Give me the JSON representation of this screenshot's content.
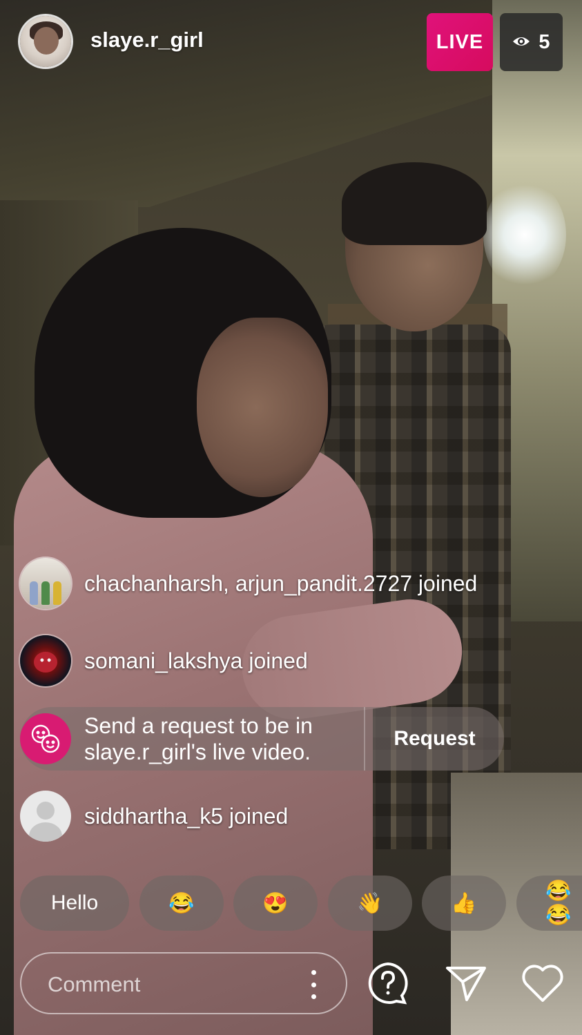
{
  "header": {
    "username": "slaye.r_girl",
    "live_label": "LIVE",
    "viewer_count": "5",
    "live_color": "#E0127A"
  },
  "comments": [
    {
      "avatar": "group-photo-avatar",
      "text": "chachanharsh, arjun_pandit.2727 joined"
    },
    {
      "avatar": "mask-avatar",
      "text": "somani_lakshya joined"
    },
    {
      "avatar": "default-avatar",
      "text": "siddhartha_k5 joined"
    }
  ],
  "request": {
    "icon": "people-smile-icon",
    "text_line1": "Send a request to be in",
    "text_line2": "slaye.r_girl's live video.",
    "button_label": "Request"
  },
  "quick_replies": [
    "Hello",
    "😂",
    "😍",
    "👋",
    "👍",
    "😂😂"
  ],
  "bottom_bar": {
    "comment_placeholder": "Comment",
    "icons": [
      "question-bubble-icon",
      "send-icon",
      "heart-icon"
    ]
  }
}
